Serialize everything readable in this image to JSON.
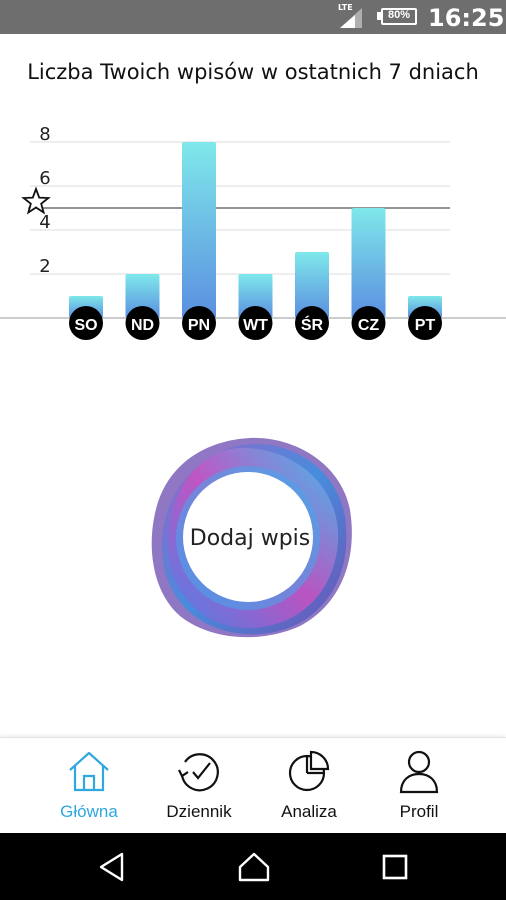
{
  "status_bar": {
    "network": "LTE",
    "battery": "80%",
    "time": "16:25"
  },
  "title": "Liczba Twoich wpisów w ostatnich 7 dniach",
  "chart_data": {
    "type": "bar",
    "categories": [
      "SO",
      "ND",
      "PN",
      "WT",
      "ŚR",
      "CZ",
      "PT"
    ],
    "values": [
      1,
      2,
      8,
      2,
      3,
      5,
      1
    ],
    "yticks": [
      2,
      4,
      6,
      8
    ],
    "ylim": [
      0,
      8
    ],
    "target_line": 5,
    "target_icon": "star-outline-icon",
    "colors": {
      "bar_top": "#7fe8ea",
      "bar_bottom": "#5a8fe0",
      "grid": "#dddddd",
      "target": "#555555",
      "badge": "#000000"
    },
    "grid": true
  },
  "add_entry": {
    "label": "Dodaj wpis"
  },
  "bottom_nav": {
    "active_color": "#2fa7df",
    "items": [
      {
        "label": "Główna",
        "icon": "home-icon"
      },
      {
        "label": "Dziennik",
        "icon": "history-clock-icon"
      },
      {
        "label": "Analiza",
        "icon": "pie-chart-icon"
      },
      {
        "label": "Profil",
        "icon": "user-icon"
      }
    ]
  },
  "system_nav": {
    "icons": [
      "back-icon",
      "home-circle-icon",
      "recents-icon"
    ]
  }
}
